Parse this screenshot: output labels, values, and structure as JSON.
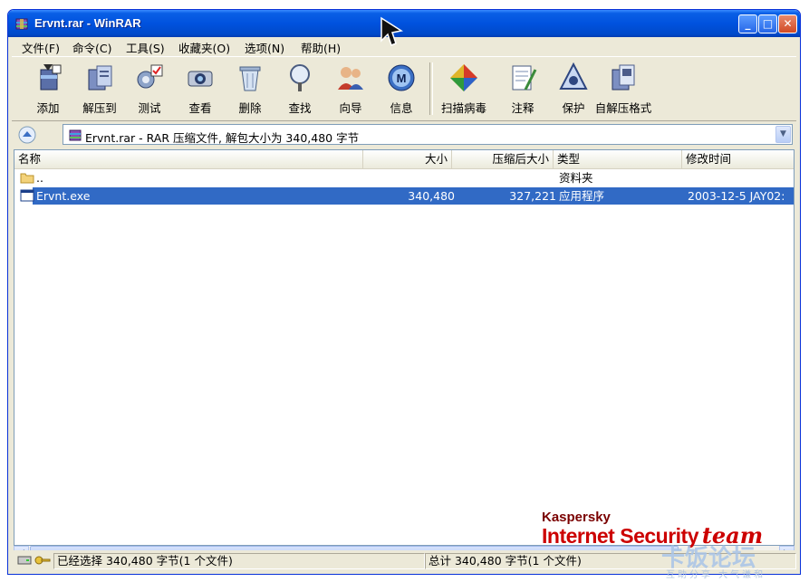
{
  "window": {
    "title": "Ervnt.rar - WinRAR"
  },
  "menubar": {
    "items": [
      {
        "label": "文件(F)"
      },
      {
        "label": "命令(C)"
      },
      {
        "label": "工具(S)"
      },
      {
        "label": "收藏夹(O)"
      },
      {
        "label": "选项(N)"
      },
      {
        "label": "帮助(H)"
      }
    ]
  },
  "toolbar": {
    "buttons": [
      {
        "label": "添加",
        "icon": "add-archive-icon"
      },
      {
        "label": "解压到",
        "icon": "extract-icon"
      },
      {
        "label": "测试",
        "icon": "test-icon"
      },
      {
        "label": "查看",
        "icon": "view-icon"
      },
      {
        "label": "删除",
        "icon": "delete-icon"
      },
      {
        "label": "查找",
        "icon": "find-icon"
      },
      {
        "label": "向导",
        "icon": "wizard-icon"
      },
      {
        "label": "信息",
        "icon": "info-icon"
      },
      {
        "label": "扫描病毒",
        "icon": "virus-scan-icon"
      },
      {
        "label": "注释",
        "icon": "comment-icon"
      },
      {
        "label": "保护",
        "icon": "protect-icon"
      },
      {
        "label": "自解压格式",
        "icon": "sfx-icon"
      }
    ]
  },
  "address": {
    "text": "Ervnt.rar - RAR 压缩文件, 解包大小为 340,480 字节"
  },
  "columns": [
    "名称",
    "大小",
    "压缩后大小",
    "类型",
    "修改时间"
  ],
  "files": [
    {
      "name": "..",
      "size": "",
      "packed": "",
      "type": "资料夹",
      "modified": "",
      "selected": false,
      "icon": "folder-icon"
    },
    {
      "name": "Ervnt.exe",
      "size": "340,480",
      "packed": "327,221",
      "type": "应用程序",
      "modified": "2003-12-5 JAY02:",
      "selected": true,
      "icon": "exe-icon"
    }
  ],
  "status": {
    "left": "已经选择 340,480 字节(1 个文件)",
    "right": "总计 340,480 字节(1 个文件)"
  },
  "watermark": {
    "line1": "Kaspersky",
    "line2": "Internet Security",
    "line3": "team",
    "forum": "卡饭论坛",
    "slogan": "互助分享 大气谦和"
  },
  "colors": {
    "title_bar": "#0052de",
    "selection": "#316ac5",
    "window_bg": "#ece9d8"
  }
}
